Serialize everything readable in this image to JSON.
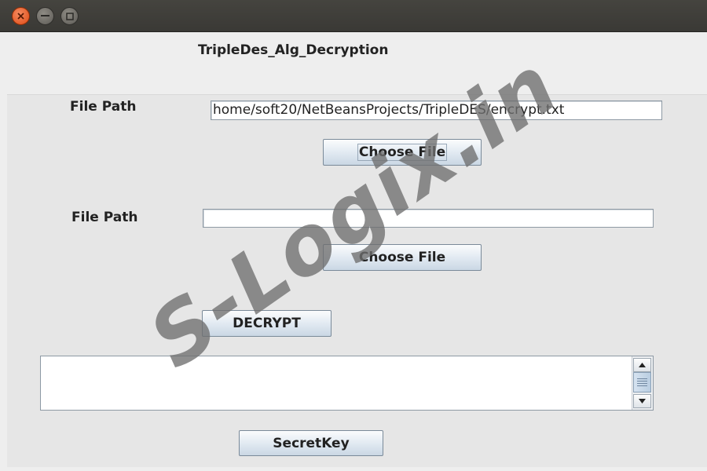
{
  "window": {
    "close_icon": "close-icon",
    "minimize_icon": "minimize-icon",
    "maximize_icon": "maximize-icon"
  },
  "heading": "TripleDes_Alg_Decryption",
  "section1": {
    "label": "File Path",
    "value": "home/soft20/NetBeansProjects/TripleDES/encrypt.txt",
    "button": "Choose File"
  },
  "section2": {
    "label": "File Path",
    "value": "",
    "button": "Choose File"
  },
  "decrypt_button": "DECRYPT",
  "output_area": {
    "value": "",
    "scroll_up_icon": "arrow-up-icon",
    "scroll_down_icon": "arrow-down-icon"
  },
  "secretkey_button": "SecretKey",
  "watermark": "S-Logix.in",
  "colors": {
    "titlebar": "#3d3c38",
    "close_button": "#e9541f",
    "panel": "#e6e6e6",
    "button_gradient_bottom": "#cad7e4"
  }
}
